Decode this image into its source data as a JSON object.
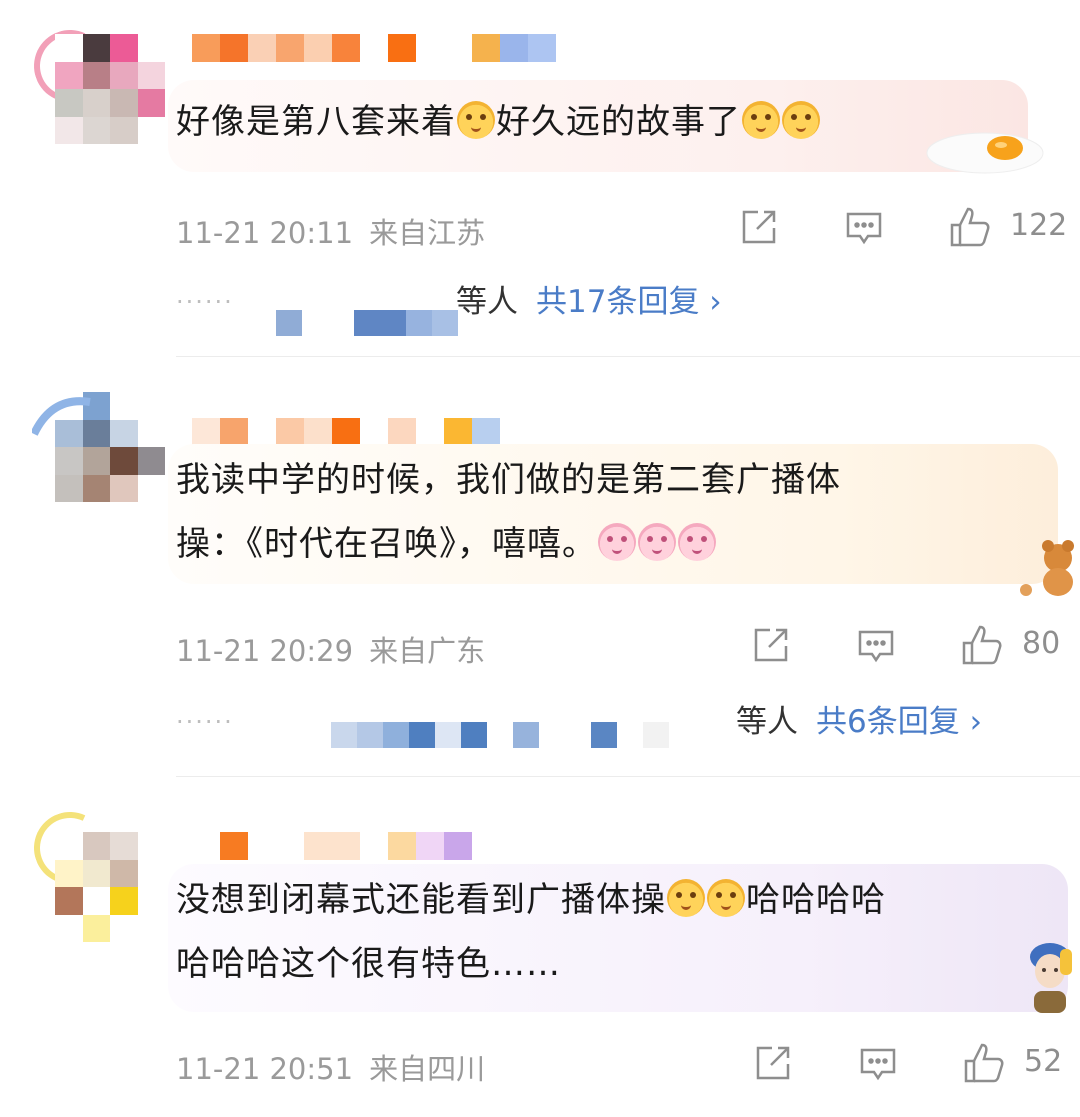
{
  "comments": [
    {
      "text_parts": [
        "好像是第八套来着",
        "好久远的故事了"
      ],
      "time": "11-21 20:11",
      "location": "来自江苏",
      "likes": "122",
      "reply_suffix": "等人",
      "reply_total": "共17条回复 ›"
    },
    {
      "text_line1": "我读中学的时候，我们做的是第二套广播体",
      "text_line2": "操：《时代在召唤》，嘻嘻。",
      "time": "11-21 20:29",
      "location": "来自广东",
      "likes": "80",
      "reply_suffix": "等人",
      "reply_total": "共6条回复 ›"
    },
    {
      "text_line1_part1": "没想到闭幕式还能看到广播体操",
      "text_line1_part2": "哈哈哈哈",
      "text_line2": "哈哈哈这个很有特色……",
      "time": "11-21 20:51",
      "location": "来自四川",
      "likes": "52"
    }
  ],
  "icons": {
    "repost": "repost-icon",
    "comment": "comment-icon",
    "like": "like-icon",
    "emoji_cat": "cat-emoji-icon",
    "emoji_pig": "pig-emoji-icon"
  },
  "colors": {
    "link_blue": "#4a7cc7",
    "meta_gray": "#9a9a9a"
  }
}
